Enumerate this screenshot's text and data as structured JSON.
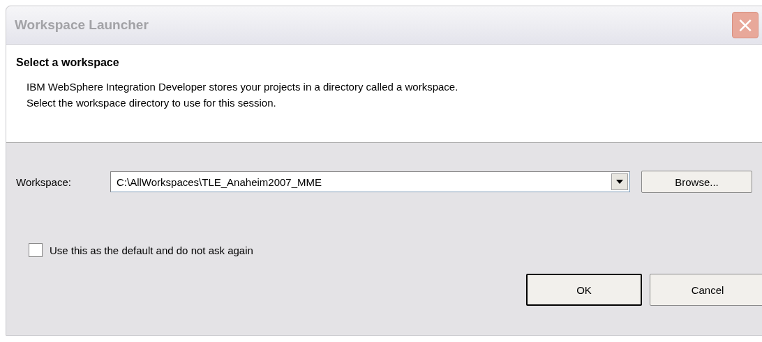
{
  "window": {
    "title": "Workspace Launcher",
    "close": "×"
  },
  "header": {
    "title": "Select a workspace",
    "description": [
      "IBM WebSphere Integration Developer stores your projects in a directory called a workspace.",
      "Select the workspace directory to use for this session."
    ]
  },
  "workspace": {
    "label": "Workspace:",
    "value": "C:\\AllWorkspaces\\TLE_Anaheim2007_MME",
    "browse": "Browse..."
  },
  "option": {
    "label": "Use this as the default and do not ask again",
    "checked": false
  },
  "buttons": [
    {
      "label": "OK",
      "default": true
    },
    {
      "label": "Cancel",
      "default": false
    }
  ]
}
